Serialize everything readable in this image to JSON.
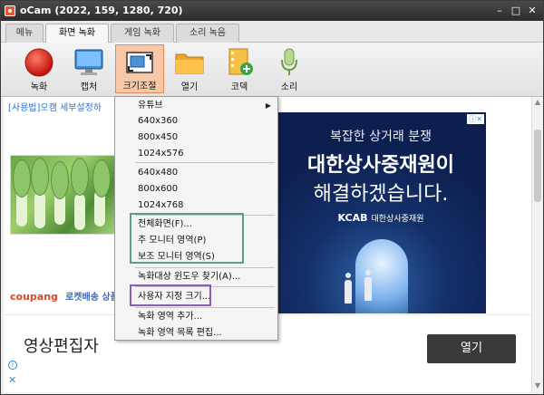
{
  "window": {
    "title": "oCam (2022, 159, 1280, 720)",
    "controls": [
      "–",
      "□",
      "✕"
    ]
  },
  "tabs": [
    {
      "label": "메뉴",
      "active": false
    },
    {
      "label": "화면 녹화",
      "active": true
    },
    {
      "label": "게임 녹화",
      "active": false
    },
    {
      "label": "소리 녹음",
      "active": false
    }
  ],
  "toolbar": {
    "record": {
      "label": "녹화",
      "icon": "record-icon"
    },
    "capture": {
      "label": "캡처",
      "icon": "monitor-icon"
    },
    "resize": {
      "label": "크기조절",
      "icon": "resize-icon"
    },
    "open": {
      "label": "열기",
      "icon": "folder-icon"
    },
    "codec": {
      "label": "코덱",
      "icon": "film-add-icon"
    },
    "sound": {
      "label": "소리",
      "icon": "microphone-icon"
    }
  },
  "menu": {
    "youtube": "유튜브",
    "sizes_a": [
      "640x360",
      "800x450",
      "1024x576"
    ],
    "sizes_b": [
      "640x480",
      "800x600",
      "1024x768"
    ],
    "fullscreen": "전체화면(F)...",
    "primary_monitor": "주 모니터 영역(P)",
    "secondary_monitor": "보조 모니터 영역(S)",
    "find_window": "녹화대상 윈도우 찾기(A)...",
    "custom_size": "사용자 지정 크기...",
    "add_area": "녹화 영역 추가...",
    "edit_area_list": "녹화 영역 목록 편집..."
  },
  "page": {
    "article_link": "[사용법]오캠 세부설정하",
    "coupang_logo": "coupang",
    "coupang_text": "로켓배송 상품,"
  },
  "ad_blue": {
    "line1": "복잡한 상거래 분쟁",
    "line2": "대한상사중재원이",
    "line3": "해결하겠습니다.",
    "brand_short": "KCAB",
    "brand_full": "대한상사중재원",
    "info_icons": "ⓘ✕"
  },
  "ad_bottom": {
    "headline": "영상편집자",
    "open_button": "열기"
  },
  "colors": {
    "titlebar": "#333333",
    "active_tool": "#f6c8a8",
    "highlight_green": "#5a9f86",
    "highlight_purple": "#8c5bb5",
    "ad_bg": "#14306a"
  }
}
